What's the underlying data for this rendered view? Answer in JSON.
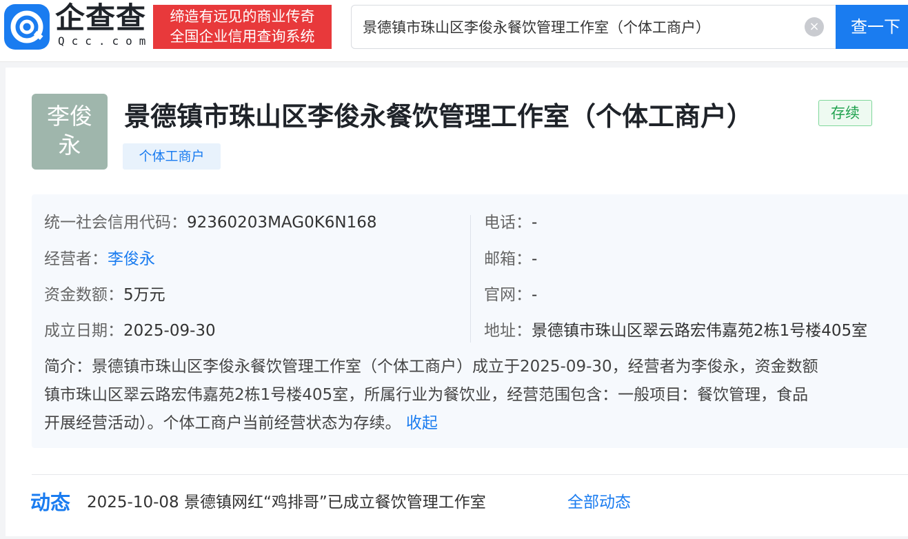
{
  "header": {
    "logo_name": "企查查",
    "logo_domain": "Qcc.com",
    "slogan_line1": "缔造有远见的商业传奇",
    "slogan_line2": "全国企业信用查询系统",
    "search_value": "景德镇市珠山区李俊永餐饮管理工作室（个体工商户）",
    "search_button": "查一下",
    "clear_symbol": "×"
  },
  "company": {
    "avatar_line1": "李俊",
    "avatar_line2": "永",
    "name": "景德镇市珠山区李俊永餐饮管理工作室（个体工商户）",
    "status": "存续",
    "type_tag": "个体工商户"
  },
  "info": {
    "credit_code_label": "统一社会信用代码：",
    "credit_code": "92360203MAG0K6N168",
    "operator_label": "经营者：",
    "operator": "李俊永",
    "capital_label": "资金数额：",
    "capital": "5万元",
    "founded_label": "成立日期：",
    "founded": "2025-09-30",
    "phone_label": "电话：",
    "phone": "-",
    "email_label": "邮箱：",
    "email": "-",
    "website_label": "官网：",
    "website": "-",
    "address_label": "地址：",
    "address": "景德镇市珠山区翠云路宏伟嘉苑2栋1号楼405室"
  },
  "intro": {
    "line1": "简介：景德镇市珠山区李俊永餐饮管理工作室（个体工商户）成立于2025-09-30，经营者为李俊永，资金数额",
    "line2": "镇市珠山区翠云路宏伟嘉苑2栋1号楼405室，所属行业为餐饮业，经营范围包含：一般项目：餐饮管理，食品",
    "line3": "开展经营活动）。个体工商户当前经营状态为存续。",
    "collapse": "收起"
  },
  "news": {
    "title": "动态",
    "text": "2025-10-08 景德镇网红“鸡排哥”已成立餐饮管理工作室",
    "all_link": "全部动态"
  },
  "colors": {
    "brand_blue": "#1a7cf0",
    "slogan_red": "#e8393b",
    "status_green": "#21a24f",
    "avatar_bg": "#9fb6ac"
  },
  "icons": {
    "logo": "qcc-logo-icon",
    "clear": "clear-icon"
  }
}
